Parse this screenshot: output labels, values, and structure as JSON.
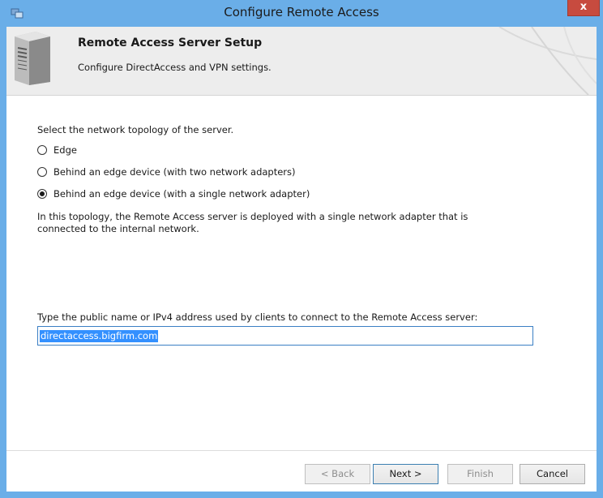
{
  "window": {
    "title": "Configure Remote Access",
    "close_label": "x"
  },
  "header": {
    "title": "Remote Access Server Setup",
    "subtitle": "Configure DirectAccess and VPN settings."
  },
  "topology": {
    "prompt": "Select the network topology of the server.",
    "options": [
      {
        "label": "Edge",
        "selected": false
      },
      {
        "label": "Behind an edge device (with two network adapters)",
        "selected": false
      },
      {
        "label": "Behind an edge device (with a single network adapter)",
        "selected": true
      }
    ],
    "description_line1": "In this topology, the Remote Access server is deployed with a single network adapter that is",
    "description_line2": "connected to the internal network."
  },
  "public_name": {
    "label": "Type the public name or IPv4 address used by clients to connect to the Remote Access server:",
    "value": "directaccess.bigfirm.com"
  },
  "buttons": {
    "back": "< Back",
    "next": "Next >",
    "finish": "Finish",
    "cancel": "Cancel"
  },
  "colors": {
    "frame": "#6aaee8",
    "close": "#c74b3f",
    "selection": "#3390ff"
  }
}
